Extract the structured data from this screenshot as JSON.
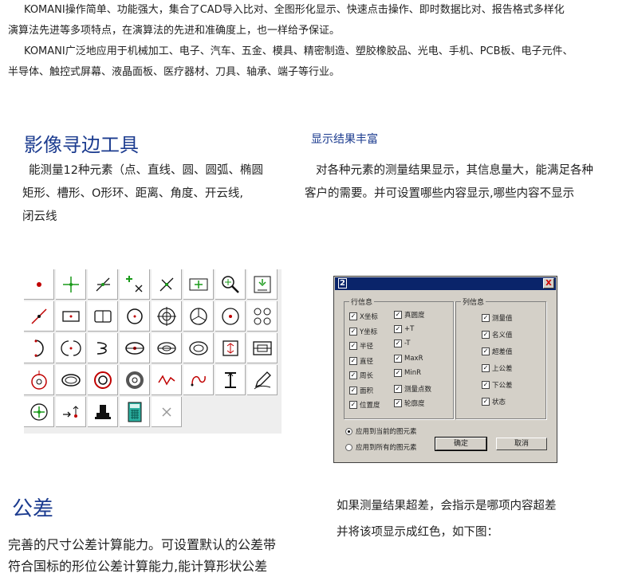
{
  "intro": {
    "p1_line1": "KOMANI操作简单、功能强大，集合了CAD导入比对、全图形化显示、快速点击操作、即时数据比对、报告格式多样化",
    "p1_line2": "演算法先进等多项特点，在演算法的先进和准确度上，也一样给予保证。",
    "p2_line1": "KOMANI广泛地应用于机械加工、电子、汽车、五金、模具、精密制造、塑胶橡胶品、光电、手机、PCB板、电子元件、",
    "p2_line2": "半导体、触控式屏幕、液晶面板、医疗器材、刀具、轴承、端子等行业。"
  },
  "edge_tool": {
    "title": "影像寻边工具",
    "line1": "能测量12种元素（点、直线、圆、圆弧、椭圆",
    "line2": "矩形、槽形、O形环、距离、角度、开云线,",
    "line3": "闭云线"
  },
  "results": {
    "title": "显示结果丰富",
    "line1": "对各种元素的测量结果显示，其信息量大，能满足各种",
    "line2": "客户的需要。并可设置哪些内容显示,哪些内容不显示"
  },
  "tool_icons": [
    "point-icon",
    "line-cross-icon",
    "diagonal-cross-icon",
    "multi-point-icon",
    "angle-cross-icon",
    "span-measure-icon",
    "zoom-icon",
    "focus-icon",
    "line-segment-icon",
    "rectangle-icon",
    "slot-icon",
    "circle-icon",
    "target-circle-icon",
    "arc-segment-icon",
    "center-circle-icon",
    "four-circles-icon",
    "open-arc-icon",
    "arc-pair-icon",
    "curve-icon",
    "ellipse-icon",
    "ellipse-target-icon",
    "o-ring-icon",
    "rect-measure-icon",
    "box-measure-icon",
    "gear-circle-icon",
    "double-ellipse-icon",
    "ring-icon",
    "thick-ring-icon",
    "wave-icon",
    "cloud-curve-icon",
    "height-gauge-icon",
    "pencil-icon",
    "crosshair-circle-icon",
    "arrow-point-icon",
    "stand-icon",
    "calculator-icon",
    "close-icon"
  ],
  "dialog": {
    "title": "2",
    "close_label": "X",
    "row_group": "行信息",
    "col_group": "列信息",
    "row_col1": [
      "X坐标",
      "Y坐标",
      "半径",
      "直径",
      "周长",
      "面积",
      "位置度"
    ],
    "row_col2": [
      "真圆度",
      "+T",
      "-T",
      "MaxR",
      "MinR",
      "测量点数",
      "轮廓度"
    ],
    "col_items": [
      "测量值",
      "名义值",
      "超差值",
      "上公差",
      "下公差",
      "状态"
    ],
    "radio1": "应用到当前的图元素",
    "radio2": "应用到所有的图元素",
    "ok": "确定",
    "cancel": "取消"
  },
  "tolerance": {
    "title": "公差",
    "line1": "完善的尺寸公差计算能力。可设置默认的公差带",
    "line2": "符合国标的形位公差计算能力,能计算形状公差"
  },
  "over_tol": {
    "line1": "如果测量结果超差，会指示是哪项内容超差",
    "line2": "并将该项显示成红色，如下图："
  },
  "colors": {
    "heading_blue": "#1b3b8f",
    "titlebar": "#0a246a",
    "dialog_face": "#d4d0c8",
    "accent_red": "#c00000",
    "icon_green": "#1a9a1a"
  }
}
